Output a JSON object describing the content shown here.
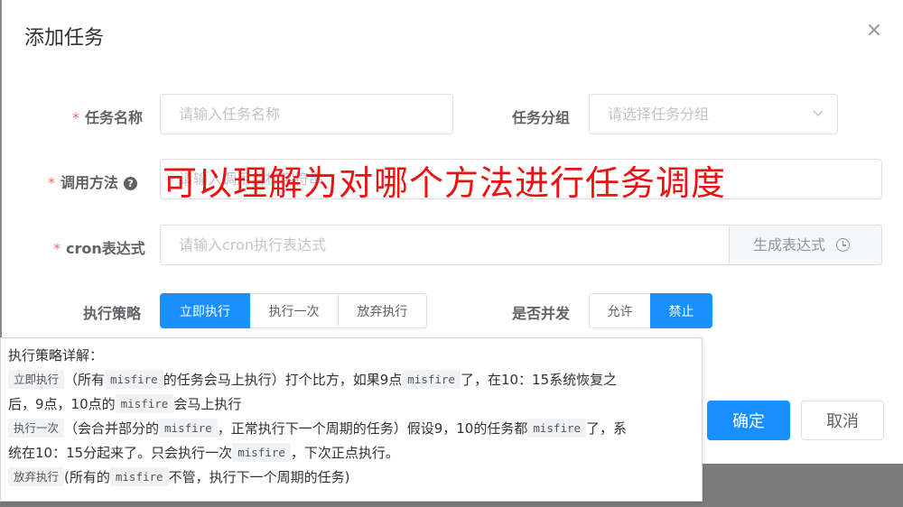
{
  "dialog": {
    "title": "添加任务",
    "close_icon": "×"
  },
  "form": {
    "task_name": {
      "required_mark": "*",
      "label": "任务名称",
      "placeholder": "请输入任务名称"
    },
    "task_group": {
      "label": "任务分组",
      "placeholder": "请选择任务分组"
    },
    "invoke_method": {
      "required_mark": "*",
      "label": "调用方法",
      "help_icon": "?",
      "placeholder": "请输入调用目标字符串"
    },
    "cron": {
      "required_mark": "*",
      "label": "cron表达式",
      "placeholder": "请输入cron执行表达式",
      "generate_label": "生成表达式"
    },
    "misfire_policy": {
      "label": "执行策略",
      "options": [
        "立即执行",
        "执行一次",
        "放弃执行"
      ],
      "selected": "立即执行"
    },
    "concurrent": {
      "label": "是否并发",
      "options": [
        "允许",
        "禁止"
      ],
      "selected": "禁止"
    }
  },
  "annotation": "可以理解为对哪个方法进行任务调度",
  "footer": {
    "confirm": "确定",
    "cancel": "取消"
  },
  "tooltip": {
    "title": "执行策略详解：",
    "line1": {
      "tag": "立即执行",
      "t1": "（所有",
      "code1": "misfire",
      "t2": "的任务会马上执行）打个比方，如果9点",
      "code2": "misfire",
      "t3": "了，在10：15系统恢复之"
    },
    "line2": {
      "t1": "后，9点，10点的",
      "code1": "misfire",
      "t2": "会马上执行"
    },
    "line3": {
      "tag": "执行一次",
      "t1": "（会合并部分的",
      "code1": "misfire",
      "t2": "，正常执行下一个周期的任务）假设9，10的任务都",
      "code2": "misfire",
      "t3": "了，系"
    },
    "line4": {
      "t1": "统在10：15分起来了。只会执行一次",
      "code1": "misfire",
      "t2": "，下次正点执行。"
    },
    "line5": {
      "tag": "放弃执行",
      "t1": "(所有的",
      "code1": "misfire",
      "t2": "不管，执行下一个周期的任务)"
    }
  },
  "colors": {
    "primary": "#1890ff",
    "required": "#f56c6c",
    "annotation": "#ee1111",
    "overlay": "#7c7c7c"
  },
  "icons": {
    "chevron": "chevron-down-icon",
    "clock": "clock-icon",
    "help": "question-circle-icon",
    "close": "close-icon"
  }
}
